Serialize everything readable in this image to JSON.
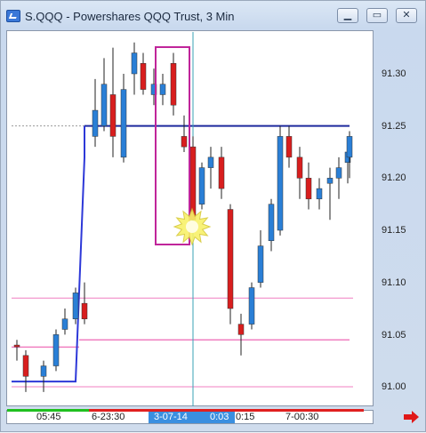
{
  "window": {
    "title": "S.QQQ - Powershares QQQ Trust, 3 Min",
    "min_icon": "minimize-icon",
    "max_icon": "maximize-icon",
    "close_icon": "close-icon",
    "min_glyph": "▁",
    "max_glyph": "▭",
    "close_glyph": "✕"
  },
  "y_axis": {
    "ticks": [
      "91.30",
      "91.25",
      "91.20",
      "91.15",
      "91.10",
      "91.05",
      "91.00"
    ]
  },
  "x_axis": {
    "labels": [
      "05:45",
      "6-23:30",
      "0:15",
      "7-00:30"
    ],
    "selected_label_date": "3-07-14",
    "selected_label_time": "0:03"
  },
  "colors": {
    "up": "#2a7fd6",
    "down": "#d81e1e",
    "resistance": "#1f2a9e",
    "highlight_box": "#c0259a",
    "crosshair": "#3aa3b5",
    "pink_lines": "#f07fc0",
    "trend": "#2d38d8",
    "selection": "#3a8fe0"
  },
  "chart_data": {
    "type": "candlestick",
    "ylim": [
      90.985,
      91.325
    ],
    "resistance_level": 91.25,
    "support_levels": [
      91.085,
      91.045,
      91.0
    ],
    "candles": [
      {
        "o": 91.04,
        "h": 91.045,
        "l": 91.025,
        "c": 91.04,
        "up": false
      },
      {
        "o": 91.03,
        "h": 91.035,
        "l": 90.995,
        "c": 91.01,
        "up": false
      },
      {
        "o": 91.01,
        "h": 91.025,
        "l": 90.995,
        "c": 91.02,
        "up": true
      },
      {
        "o": 91.02,
        "h": 91.055,
        "l": 91.015,
        "c": 91.05,
        "up": true
      },
      {
        "o": 91.055,
        "h": 91.075,
        "l": 91.05,
        "c": 91.065,
        "up": true
      },
      {
        "o": 91.065,
        "h": 91.095,
        "l": 91.06,
        "c": 91.09,
        "up": true
      },
      {
        "o": 91.08,
        "h": 91.1,
        "l": 91.06,
        "c": 91.065,
        "up": false
      },
      {
        "o": 91.24,
        "h": 91.295,
        "l": 91.23,
        "c": 91.265,
        "up": true
      },
      {
        "o": 91.25,
        "h": 91.315,
        "l": 91.245,
        "c": 91.29,
        "up": true
      },
      {
        "o": 91.28,
        "h": 91.325,
        "l": 91.22,
        "c": 91.24,
        "up": false
      },
      {
        "o": 91.22,
        "h": 91.3,
        "l": 91.215,
        "c": 91.285,
        "up": true
      },
      {
        "o": 91.3,
        "h": 91.33,
        "l": 91.28,
        "c": 91.32,
        "up": true
      },
      {
        "o": 91.31,
        "h": 91.32,
        "l": 91.28,
        "c": 91.285,
        "up": false
      },
      {
        "o": 91.29,
        "h": 91.305,
        "l": 91.27,
        "c": 91.28,
        "up": true
      },
      {
        "o": 91.28,
        "h": 91.3,
        "l": 91.27,
        "c": 91.29,
        "up": true
      },
      {
        "o": 91.31,
        "h": 91.32,
        "l": 91.26,
        "c": 91.27,
        "up": false
      },
      {
        "o": 91.24,
        "h": 91.26,
        "l": 91.225,
        "c": 91.23,
        "up": false
      },
      {
        "o": 91.23,
        "h": 91.24,
        "l": 91.15,
        "c": 91.16,
        "up": false
      },
      {
        "o": 91.175,
        "h": 91.215,
        "l": 91.17,
        "c": 91.21,
        "up": true
      },
      {
        "o": 91.21,
        "h": 91.23,
        "l": 91.19,
        "c": 91.22,
        "up": true
      },
      {
        "o": 91.22,
        "h": 91.23,
        "l": 91.18,
        "c": 91.19,
        "up": false
      },
      {
        "o": 91.17,
        "h": 91.175,
        "l": 91.06,
        "c": 91.075,
        "up": false
      },
      {
        "o": 91.06,
        "h": 91.07,
        "l": 91.03,
        "c": 91.05,
        "up": false
      },
      {
        "o": 91.06,
        "h": 91.1,
        "l": 91.055,
        "c": 91.095,
        "up": true
      },
      {
        "o": 91.1,
        "h": 91.15,
        "l": 91.095,
        "c": 91.135,
        "up": true
      },
      {
        "o": 91.14,
        "h": 91.18,
        "l": 91.13,
        "c": 91.175,
        "up": true
      },
      {
        "o": 91.15,
        "h": 91.25,
        "l": 91.145,
        "c": 91.24,
        "up": true
      },
      {
        "o": 91.24,
        "h": 91.25,
        "l": 91.21,
        "c": 91.22,
        "up": false
      },
      {
        "o": 91.22,
        "h": 91.23,
        "l": 91.18,
        "c": 91.2,
        "up": false
      },
      {
        "o": 91.2,
        "h": 91.215,
        "l": 91.17,
        "c": 91.18,
        "up": false
      },
      {
        "o": 91.19,
        "h": 91.2,
        "l": 91.17,
        "c": 91.18,
        "up": true
      },
      {
        "o": 91.2,
        "h": 91.21,
        "l": 91.16,
        "c": 91.195,
        "up": true
      },
      {
        "o": 91.2,
        "h": 91.22,
        "l": 91.18,
        "c": 91.21,
        "up": true
      },
      {
        "o": 91.215,
        "h": 91.23,
        "l": 91.195,
        "c": 91.225,
        "up": true
      },
      {
        "o": 91.22,
        "h": 91.245,
        "l": 91.2,
        "c": 91.24,
        "up": true
      }
    ]
  }
}
